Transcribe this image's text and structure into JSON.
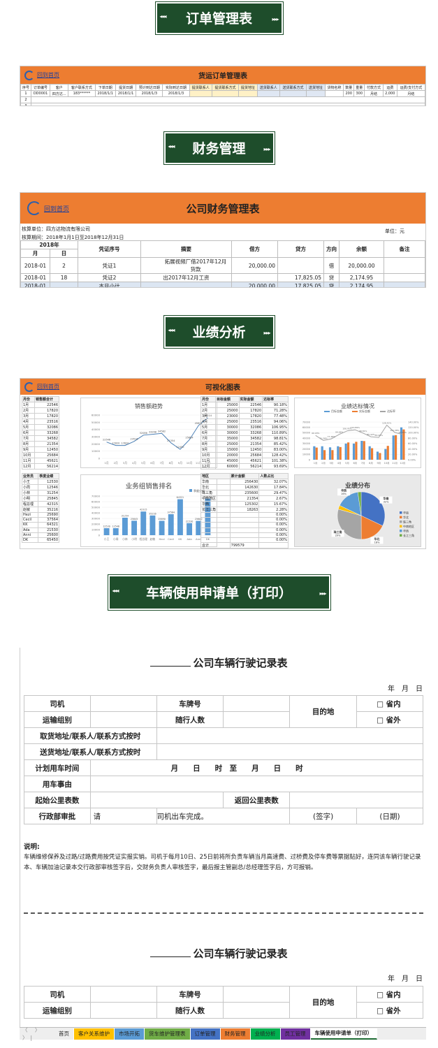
{
  "banners": {
    "orders": "订单管理表",
    "finance": "财务管理",
    "performance": "业绩分析",
    "vehicle": "车辆使用申请单（打印）"
  },
  "sheet1": {
    "home_link": "回到首页",
    "title": "货运订单管理表",
    "headers": [
      "序号",
      "订单编号",
      "客户",
      "客户联系方式",
      "下单日期",
      "提货日期",
      "预计到达日期",
      "实际到达日期",
      "提货联系人",
      "提货联系方式",
      "提货地址",
      "送货联系人",
      "送货联系方式",
      "送货地址",
      "货物名称",
      "数量",
      "重量",
      "付款方式",
      "运费",
      "运费/支付方式"
    ],
    "row1": [
      "1",
      "DD0001",
      "四方达...",
      "183******",
      "2018/1/1",
      "2018/1/1",
      "2018/1/3",
      "2018/1/3",
      "",
      "",
      "",
      "",
      "",
      "",
      "",
      "200",
      "300",
      "月结",
      "2,000",
      "月结"
    ],
    "row_numbers": [
      "2",
      "3",
      "4"
    ]
  },
  "sheet2": {
    "home_link": "回到首页",
    "title": "公司财务管理表",
    "unit_label": "核算单位：",
    "unit_value": "四方达物流有限公司",
    "period_label": "核算期间：",
    "period_value": "2018年1月1日至2018年12月31日",
    "currency": "单位：元",
    "year_header": "2018年",
    "month_header": "月",
    "day_header": "日",
    "voucher_header": "凭证序号",
    "headers": [
      "摘要",
      "借方",
      "贷方",
      "方向",
      "余额",
      "备注"
    ],
    "rows": [
      [
        "2018-01",
        "2",
        "凭证1",
        "拓展视频厂借2017年12月货款",
        "20,000.00",
        "",
        "借",
        "20,000.00",
        ""
      ],
      [
        "2018-01",
        "18",
        "凭证2",
        "出2017年12月工资",
        "",
        "17,825.05",
        "贷",
        "2,174.95",
        ""
      ],
      [
        "2018-01",
        "",
        "本月小计",
        "",
        "20,000.00",
        "17,825.05",
        "贷",
        "2,174.95",
        ""
      ]
    ],
    "dash": "-"
  },
  "sheet3": {
    "home_link": "回到首页",
    "title": "可视化图表",
    "monthly_headers": [
      "月份",
      "销售额合计"
    ],
    "monthly": [
      [
        "1月",
        "22546"
      ],
      [
        "2月",
        "17820"
      ],
      [
        "3月",
        "17820"
      ],
      [
        "4月",
        "23516"
      ],
      [
        "5月",
        "32086"
      ],
      [
        "6月",
        "33268"
      ],
      [
        "7月",
        "34582"
      ],
      [
        "8月",
        "21354"
      ],
      [
        "9月",
        "12450"
      ],
      [
        "10月",
        "25684"
      ],
      [
        "11月",
        "45621"
      ],
      [
        "12月",
        "56214"
      ]
    ],
    "target_headers": [
      "月份",
      "目标金额",
      "实际金额",
      "达标率"
    ],
    "target": [
      [
        "1月",
        "25000",
        "22546",
        "90.18%"
      ],
      [
        "2月",
        "25000",
        "17820",
        "71.28%"
      ],
      [
        "3月",
        "23000",
        "17820",
        "77.48%"
      ],
      [
        "4月",
        "25000",
        "23516",
        "94.06%"
      ],
      [
        "5月",
        "30000",
        "32086",
        "106.95%"
      ],
      [
        "6月",
        "30000",
        "33268",
        "110.89%"
      ],
      [
        "7月",
        "35000",
        "34582",
        "98.81%"
      ],
      [
        "8月",
        "25000",
        "21354",
        "85.42%"
      ],
      [
        "9月",
        "15000",
        "12450",
        "83.00%"
      ],
      [
        "10月",
        "20000",
        "25684",
        "128.42%"
      ],
      [
        "11月",
        "45000",
        "45621",
        "101.38%"
      ],
      [
        "12月",
        "60000",
        "56214",
        "93.69%"
      ]
    ],
    "staff_headers": [
      "业务员",
      "季度业绩"
    ],
    "staff": [
      [
        "小王",
        "12530"
      ],
      [
        "小周",
        "12546"
      ],
      [
        "小林",
        "31254"
      ],
      [
        "小明",
        "25845"
      ],
      [
        "程总理",
        "42315"
      ],
      [
        "赵敏",
        "35216"
      ],
      [
        "Hezi",
        "25690"
      ],
      [
        "Cecil",
        "37564"
      ],
      [
        "KK",
        "64321"
      ],
      [
        "Ada",
        "21530"
      ],
      [
        "Anni",
        "25600"
      ],
      [
        "DK",
        "65450"
      ]
    ],
    "region_headers": [
      "地区",
      "累计金额",
      "人数占比"
    ],
    "region": [
      [
        "华南",
        "256430",
        "32.07%"
      ],
      [
        "华北",
        "142630",
        "17.84%"
      ],
      [
        "珠三角",
        "235600",
        "29.47%"
      ],
      [
        "中南地区",
        "21354",
        "2.67%"
      ],
      [
        "华西",
        "125302",
        "15.67%"
      ],
      [
        "长江三角",
        "18263",
        "2.28%"
      ],
      [
        "",
        "",
        "0.00%"
      ],
      [
        "",
        "",
        "0.00%"
      ],
      [
        "",
        "",
        "0.00%"
      ],
      [
        "",
        "",
        "0.00%"
      ],
      [
        "",
        "",
        "0.00%"
      ],
      [
        "",
        "",
        "0.00%"
      ]
    ],
    "region_total": [
      "合计",
      "799579",
      ""
    ],
    "chart_titles": {
      "sales_trend": "销售额趋势",
      "target_rate": "业绩达标情况",
      "staff_rank": "业务组销售排名",
      "region_pie": "业绩分布"
    }
  },
  "chart_data": [
    {
      "type": "line",
      "title": "销售额趋势",
      "categories": [
        "1月",
        "2月",
        "3月",
        "4月",
        "5月",
        "6月",
        "7月",
        "8月",
        "9月",
        "10月",
        "11月",
        "12月"
      ],
      "values": [
        22546,
        17820,
        17820,
        23516,
        32086,
        33268,
        34582,
        21354,
        12450,
        25684,
        45621,
        56214
      ],
      "ylim": [
        0,
        60000
      ],
      "yticks": [
        0,
        10000,
        20000,
        30000,
        40000,
        50000,
        60000
      ],
      "xlabel": "",
      "ylabel": ""
    },
    {
      "type": "bar",
      "title": "业绩达标情况",
      "categories": [
        "1月",
        "2月",
        "3月",
        "4月",
        "5月",
        "6月",
        "7月",
        "8月",
        "9月",
        "10月",
        "11月",
        "12月"
      ],
      "series": [
        {
          "name": "目标金额",
          "values": [
            25000,
            25000,
            23000,
            25000,
            30000,
            30000,
            35000,
            25000,
            15000,
            20000,
            45000,
            60000
          ],
          "color": "#5b9bd5"
        },
        {
          "name": "实际金额",
          "values": [
            22546,
            17820,
            17820,
            23516,
            32086,
            33268,
            34582,
            21354,
            12450,
            25684,
            45621,
            56214
          ],
          "color": "#ed7d31"
        },
        {
          "name": "达标率",
          "values": [
            90.18,
            71.28,
            77.48,
            94.06,
            106.95,
            110.89,
            98.81,
            85.42,
            83.0,
            128.42,
            101.38,
            93.69
          ],
          "color": "#a5a5a5"
        }
      ],
      "ylim": [
        0,
        70000
      ],
      "y2lim": [
        0,
        140
      ]
    },
    {
      "type": "bar",
      "title": "业务组销售排名",
      "categories": [
        "小王",
        "小周",
        "小林",
        "小明",
        "程总理",
        "赵敏",
        "Hezi",
        "Cecil",
        "KK",
        "Ada",
        "Anni",
        "DK"
      ],
      "values": [
        12530,
        12546,
        31254,
        25845,
        42315,
        35216,
        25690,
        37564,
        64321,
        21530,
        25600,
        65450
      ],
      "legend": "季度业绩",
      "ylim": [
        0,
        70000
      ],
      "color": "#5b9bd5"
    },
    {
      "type": "pie",
      "title": "业绩分布",
      "labels": [
        "华南",
        "华北",
        "珠三角",
        "中南地区",
        "华西",
        "长江三角"
      ],
      "values": [
        32.07,
        17.84,
        29.47,
        2.67,
        15.67,
        2.28
      ],
      "colors": [
        "#4472c4",
        "#ed7d31",
        "#a5a5a5",
        "#ffc000",
        "#5b9bd5",
        "#70ad47"
      ],
      "legend_labels": [
        "华南",
        "华北",
        "珠三角",
        "中南地区",
        "华西",
        "长江三角"
      ]
    }
  ],
  "sheet4": {
    "form_title": "公司车辆行驶记录表",
    "date_line": "年　月　日",
    "driver": "司机",
    "plate": "车牌号",
    "destination": "目的地",
    "in_province": "□ 省内",
    "out_province": "□ 省外",
    "transport_group": "运输组别",
    "passengers": "随行人数",
    "pickup": "取货地址/联系人/联系方式按时",
    "delivery": "送货地址/联系人/联系方式按时",
    "planned_time": "计划用车时间",
    "time_line": "月　　日　　时　至　　月　　日　　时",
    "reason": "用车事由",
    "start_km": "起始公里表数",
    "return_km": "返回公里表数",
    "admin_approval": "行政部审批",
    "approval_please": "请",
    "approval_text": "司机出车完成。",
    "signature": "(签字)",
    "date_paren": "(日期)",
    "note_title": "说明:",
    "note_text": "车辆维修保养及过路/过路费用按凭证实报实销。司机于每月10日、25日前将所负责车辆当月高速费、过桥费及停车费等票据贴好，连同该车辆行驶记录本、车辆加油记录本交行政部审核签字后，交财务负责人审核签字，最后报主管副总/总经理签字后，方可报销。"
  },
  "tabs": {
    "nav": "〈 〉 〉|",
    "items": [
      {
        "label": "首页",
        "color": "#eeeeee"
      },
      {
        "label": "客户关系维护",
        "color": "#ffc000"
      },
      {
        "label": "市场开拓",
        "color": "#5b9bd5"
      },
      {
        "label": "货车维护管理表",
        "color": "#70ad47"
      },
      {
        "label": "订单管理",
        "color": "#4472c4"
      },
      {
        "label": "财务管理",
        "color": "#ed7d31"
      },
      {
        "label": "业绩分析",
        "color": "#00b050"
      },
      {
        "label": "员工管理",
        "color": "#7030a0"
      },
      {
        "label": "车辆使用申请单（打印）",
        "color": "#ffffff"
      }
    ]
  }
}
